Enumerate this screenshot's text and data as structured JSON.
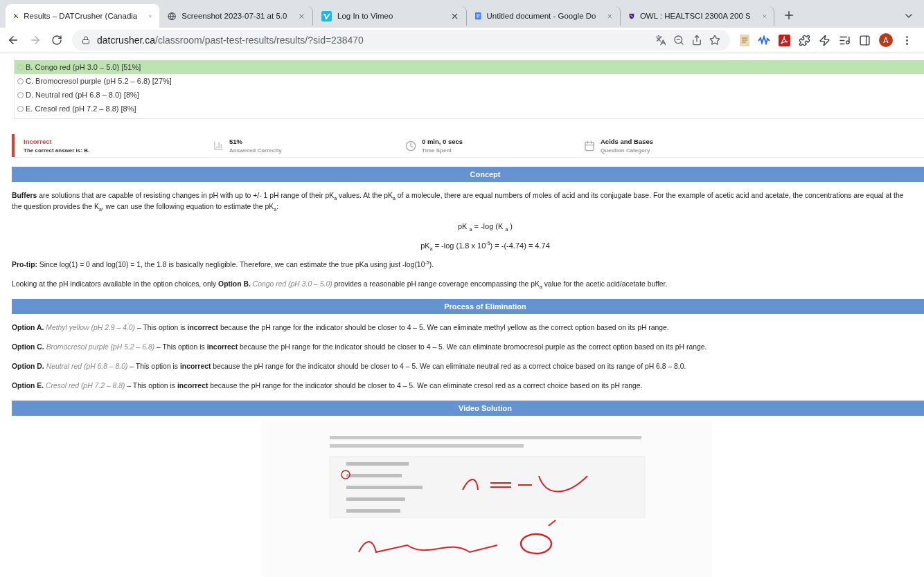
{
  "browser": {
    "tabs": [
      {
        "title": "Results – DATCrusher (Canadia",
        "selected": true
      },
      {
        "title": "Screenshot 2023-07-31 at 5.0",
        "selected": false
      },
      {
        "title": "Log In to Vimeo",
        "selected": false
      },
      {
        "title": "Untitled document - Google Do",
        "selected": false
      },
      {
        "title": "OWL : HEALTSCI 2300A 200 S",
        "selected": false
      }
    ],
    "url": {
      "domain": "datcrusher.ca",
      "path": "/classroom/past-test-results/results/?sid=238470"
    },
    "avatar": "A"
  },
  "answers": [
    {
      "label": "B. Congo red (pH 3.0 – 5.0) [51%]",
      "selected": true
    },
    {
      "label": "C. Bromocresol purple (pH 5.2 – 6.8) [27%]",
      "selected": false
    },
    {
      "label": "D. Neutral red (pH 6.8 – 8.0) [8%]",
      "selected": false
    },
    {
      "label": "E. Cresol red (pH 7.2 – 8.8) [8%]",
      "selected": false
    }
  ],
  "result": {
    "status": "Incorrect",
    "detail": "The correct answer is: B."
  },
  "stats": [
    {
      "kind": "chart",
      "value": "51%",
      "caption": "Answered Correctly"
    },
    {
      "kind": "clock",
      "value": "0 min, 0 secs",
      "caption": "Time Spent"
    },
    {
      "kind": "calendar",
      "value": "Acids and Bases",
      "caption": "Question Category"
    }
  ],
  "sections": [
    {
      "heading": "Concept",
      "blocks": [
        {
          "kind": "para",
          "lines": [
            "**Buffers** are solutions that are capable of resisting changes in pH with up to +/- 1 pH range of their pK$_{a}$ values. At the pK$_{a}$ of a molecule, there are equal numbers of moles of acid and its conjugate base. For the example of acetic acid and acetate, the concentrations are equal at the",
            "the question provides the K$_{a}$, we can use the following equation to estimate the pK$_{a}$:"
          ]
        },
        {
          "kind": "formula",
          "text": "pK $_{a}$ = -log (K $_{a}$ )"
        },
        {
          "kind": "formula",
          "text": "pK$_{a}$ = -log (1.8 x 10$^{-5}$) = -(-4.74) = 4.74"
        },
        {
          "kind": "para",
          "lines": [
            "**Pro-tip:** Since log(1) = 0 and log(10) = 1, the 1.8 is basically negligible. Therefore, we can estimate the true pKa using just -log(10$^{-5}$)."
          ]
        },
        {
          "kind": "para",
          "lines": [
            "Looking at the pH indicators available in the option choices, only **Option B.** *Congo red (pH 3.0 – 5.0)* provides a reasonable pH range coverage encompassing the pK$_{a}$ value for the acetic acid/acetate buffer."
          ]
        }
      ]
    },
    {
      "heading": "Process of Elimination",
      "blocks": [
        {
          "kind": "para",
          "lines": [
            "**Option A.** *Methyl yellow (pH 2.9 – 4.0)* – This option is **incorrect** because the pH range for the indicator should be closer to 4 – 5. We can eliminate methyl yellow as the correct option based on its pH range."
          ]
        },
        {
          "kind": "para",
          "lines": [
            "**Option C.** *Bromocresol purple (pH 5.2 – 6.8)* – This option is **incorrect** because the pH range for the indicator should be closer to 4 – 5. We can eliminate bromocresol purple as the correct option based on its pH range."
          ]
        },
        {
          "kind": "para",
          "lines": [
            "**Option D.** *Neutral red (pH 6.8 – 8.0)* – This option is **incorrect** because the pH range for the indicator should be closer to 4 – 5. We can eliminate neutral red as a correct choice based on its range of pH 6.8 – 8.0."
          ]
        },
        {
          "kind": "para",
          "lines": [
            "**Option E.** *Cresol red (pH 7.2 – 8.8)* – This option is **incorrect** because the pH range for the indicator should be closer to 4 – 5. We can eliminate cresol red as a correct choice based on its pH range."
          ]
        }
      ]
    },
    {
      "heading": "Video Solution"
    }
  ]
}
